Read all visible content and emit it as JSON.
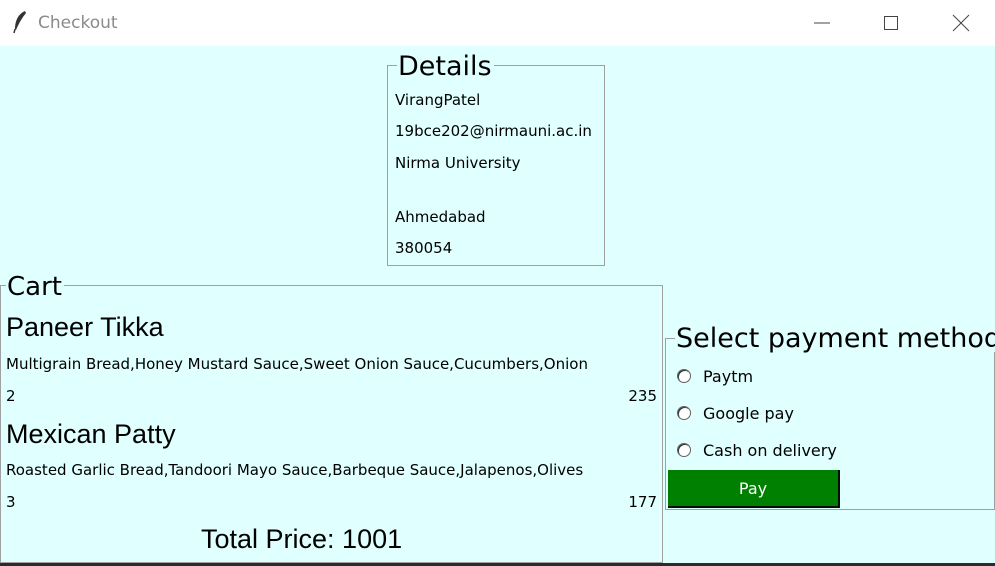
{
  "window": {
    "title": "Checkout",
    "icon": "feather-icon",
    "controls": [
      "minimize-icon",
      "maximize-icon",
      "close-icon"
    ]
  },
  "details": {
    "title": "Details",
    "name": "VirangPatel",
    "email": "19bce202@nirmauni.ac.in",
    "address": "Nirma University",
    "city": "Ahmedabad",
    "pincode": "380054"
  },
  "cart": {
    "title": "Cart",
    "items": [
      {
        "name": "Paneer Tikka",
        "toppings": "Multigrain Bread,Honey Mustard Sauce,Sweet Onion Sauce,Cucumbers,Onion",
        "quantity": "2",
        "price": "235"
      },
      {
        "name": "Mexican Patty",
        "toppings": "Roasted Garlic Bread,Tandoori Mayo Sauce,Barbeque Sauce,Jalapenos,Olives",
        "quantity": "3",
        "price": "177"
      }
    ],
    "total": "Total Price: 1001"
  },
  "payment": {
    "title": "Select payment method",
    "options": [
      "Paytm",
      "Google pay",
      "Cash on delivery"
    ],
    "pay_label": "Pay"
  },
  "colors": {
    "background": "#e0ffff",
    "pay_button": "#008000",
    "pay_text": "#ffffff"
  }
}
